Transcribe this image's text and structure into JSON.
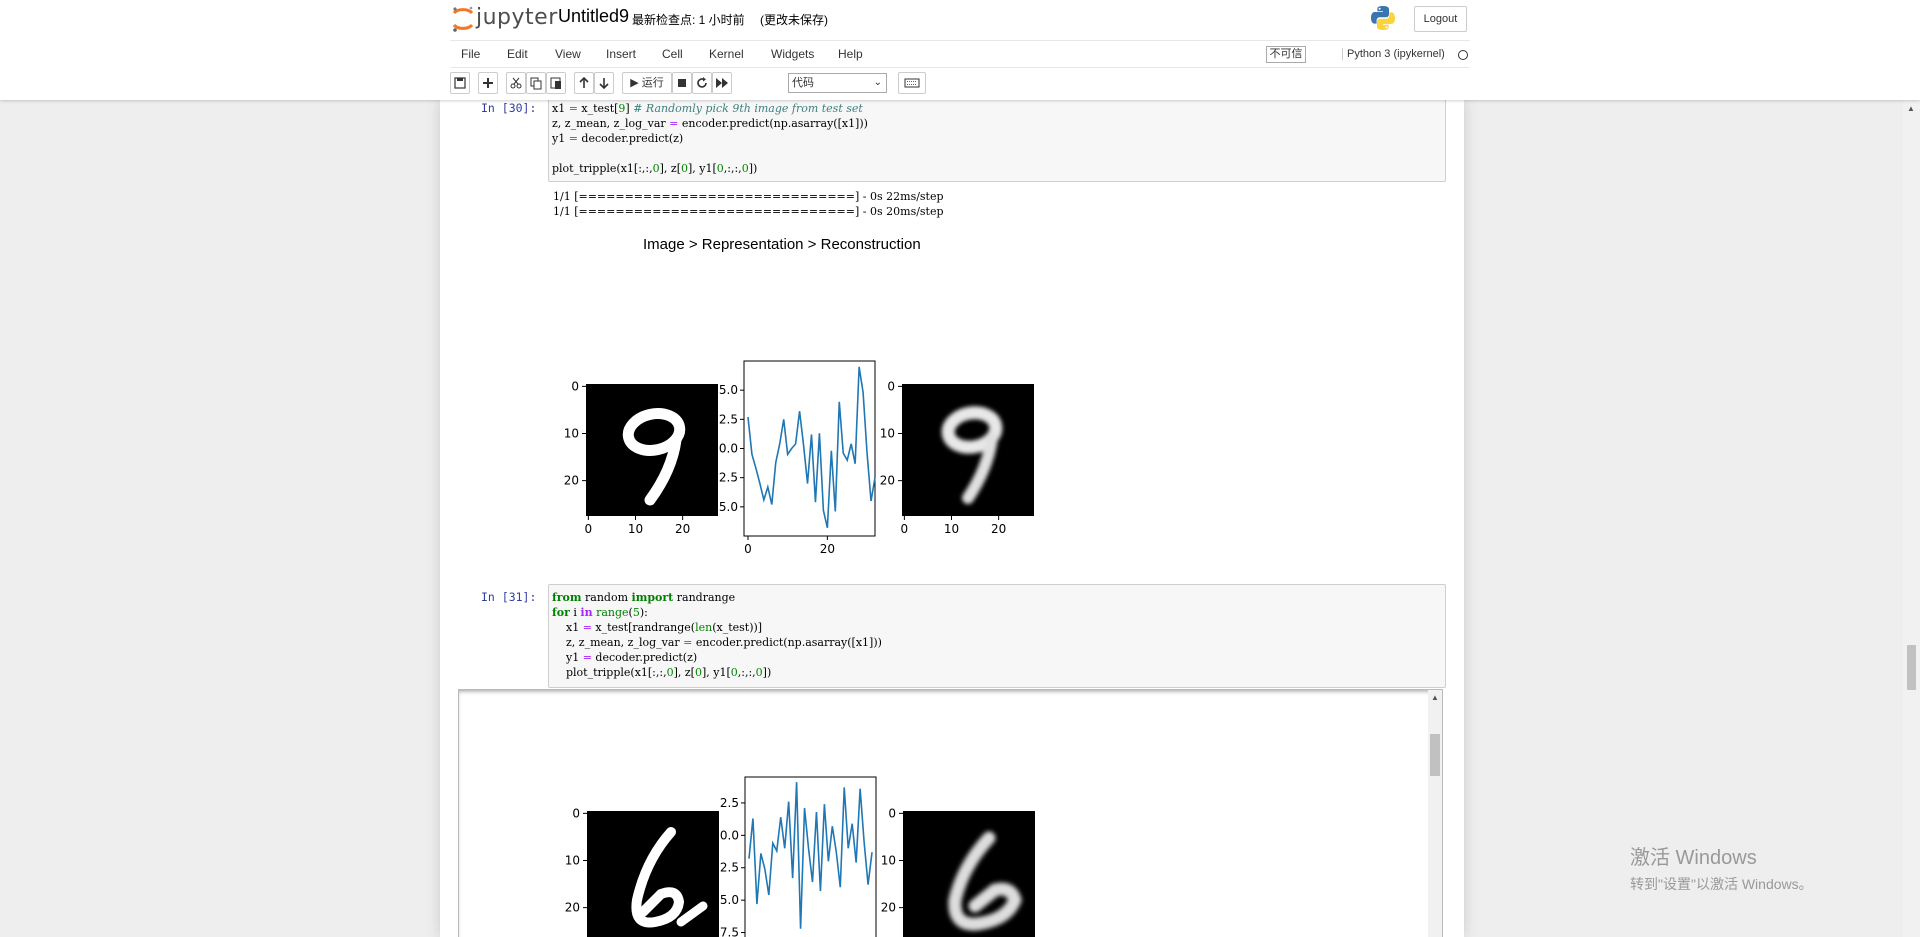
{
  "header": {
    "logo_text": "jupyter",
    "notebook_name": "Untitled9",
    "checkpoint": "最新检查点: 1 小时前",
    "unsaved": "(更改未保存)",
    "logout_label": "Logout"
  },
  "menu": {
    "items": [
      "File",
      "Edit",
      "View",
      "Insert",
      "Cell",
      "Kernel",
      "Widgets",
      "Help"
    ],
    "trusted_label": "不可信",
    "kernel_name": "Python 3 (ipykernel)"
  },
  "toolbar": {
    "run_label": "▶ 运行",
    "cell_type": "代码",
    "icons": [
      "save-icon",
      "plus-icon",
      "cut-icon",
      "copy-icon",
      "paste-icon",
      "arrow-up-icon",
      "arrow-down-icon",
      "stop-icon",
      "restart-icon",
      "fast-forward-icon",
      "keyboard-icon"
    ]
  },
  "cell30": {
    "prompt": "In  [30]:",
    "output_lines": [
      "1/1 [==============================] - 0s 22ms/step",
      "1/1 [==============================] - 0s 20ms/step"
    ],
    "figure_title": "Image > Representation > Reconstruction"
  },
  "cell31": {
    "prompt": "In  [31]:"
  },
  "chart_data": [
    {
      "type": "line",
      "panel": "cell30-representation",
      "x": [
        0,
        1,
        2,
        3,
        4,
        5,
        6,
        7,
        8,
        9,
        10,
        11,
        12,
        13,
        14,
        15,
        16,
        17,
        18,
        19,
        20,
        21,
        22,
        23,
        24,
        25,
        26,
        27,
        28,
        29,
        30,
        31
      ],
      "values": [
        2.7,
        -0.5,
        -1.7,
        -3.0,
        -4.4,
        -3.3,
        -4.8,
        -1.2,
        0.4,
        2.5,
        -0.5,
        0.0,
        0.4,
        3.2,
        0.3,
        -3.0,
        1.2,
        -4.6,
        1.3,
        -5.3,
        -6.8,
        -0.2,
        -5.4,
        4.0,
        -0.4,
        -1.0,
        0.4,
        -1.3,
        7.0,
        4.8,
        -0.4,
        -4.5,
        -2.5
      ],
      "yticks": [
        "5.0",
        "2.5",
        "0.0",
        "2.5",
        "5.0"
      ],
      "xticks": [
        "0",
        "20"
      ],
      "ylim": [
        -7.5,
        7.5
      ],
      "xlim": [
        -1,
        32
      ]
    },
    {
      "type": "line",
      "panel": "cell31-representation",
      "x": [
        0,
        1,
        2,
        3,
        4,
        5,
        6,
        7,
        8,
        9,
        10,
        11,
        12,
        13,
        14,
        15,
        16,
        17,
        18,
        19,
        20,
        21,
        22,
        23,
        24,
        25,
        26,
        27,
        28,
        29,
        30,
        31
      ],
      "values": [
        -1.8,
        1.3,
        -5.3,
        -1.4,
        -2.6,
        -4.6,
        -0.6,
        -1.2,
        1.4,
        -1.0,
        2.6,
        -3.3,
        4.1,
        -7.2,
        2.1,
        -1.0,
        -3.6,
        1.8,
        -4.3,
        2.4,
        -2.0,
        0.7,
        -1.3,
        -4.0,
        3.7,
        -1.0,
        0.9,
        -2.1,
        3.6,
        -0.5,
        -3.8,
        -1.3
      ],
      "yticks": [
        "2.5",
        "0.0",
        "2.5",
        "5.0",
        "7.5"
      ],
      "ylim": [
        -9,
        4.5
      ],
      "xlim": [
        -1,
        32
      ]
    }
  ],
  "images_axes": {
    "yticks": [
      "0",
      "10",
      "20"
    ],
    "xticks": [
      "0",
      "10",
      "20"
    ]
  },
  "watermark": {
    "line1": "激活 Windows",
    "line2": "转到\"设置\"以激活 Windows。"
  }
}
